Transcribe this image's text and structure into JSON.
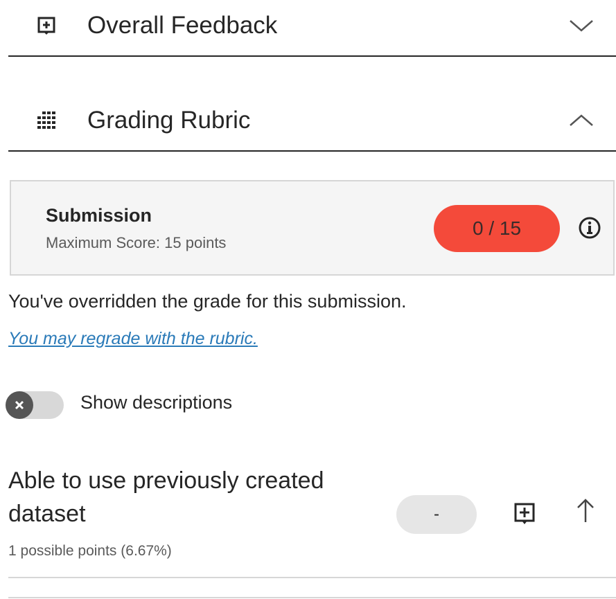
{
  "overall_feedback": {
    "title": "Overall Feedback",
    "icon": "add-comment-icon",
    "state": "collapsed"
  },
  "grading_rubric": {
    "title": "Grading Rubric",
    "icon": "rubric-grid-icon",
    "state": "expanded"
  },
  "submission": {
    "title": "Submission",
    "max_score_label": "Maximum Score: 15 points",
    "score": "0 / 15",
    "score_color": "#f44a3a"
  },
  "override": {
    "message": "You've overridden the grade for this submission.",
    "regrade_link": "You may regrade with the rubric."
  },
  "show_descriptions": {
    "label": "Show descriptions",
    "enabled": false
  },
  "criteria": [
    {
      "title": "Able to use previously created dataset",
      "points": "1 possible points (6.67%)",
      "score_value": "-"
    }
  ],
  "colors": {
    "accent_link": "#2a7ab8",
    "text": "#262626"
  }
}
